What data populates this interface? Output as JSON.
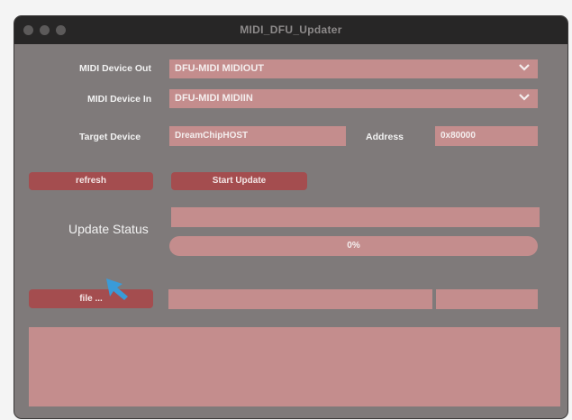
{
  "window": {
    "title": "MIDI_DFU_Updater"
  },
  "midi_out": {
    "label": "MIDI Device Out",
    "value": "DFU-MIDI MIDIOUT"
  },
  "midi_in": {
    "label": "MIDI Device In",
    "value": "DFU-MIDI MIDIIN"
  },
  "target": {
    "label": "Target Device",
    "value": "DreamChipHOST"
  },
  "address": {
    "label": "Address",
    "value": "0x80000"
  },
  "buttons": {
    "refresh": "refresh",
    "start_update": "Start Update",
    "file": "file ..."
  },
  "update_status": {
    "label": "Update Status",
    "message": "",
    "progress_text": "0%",
    "progress_fraction": 0
  },
  "file": {
    "path": "",
    "info": ""
  },
  "log": {
    "text": ""
  },
  "colors": {
    "window_bg": "#7f7a7a",
    "field_bg": "#c48d8d",
    "button_bg": "#a44d4f",
    "titlebar": "#272626",
    "cursor": "#3a9bd8"
  },
  "icons": {
    "window_controls": [
      "close-icon",
      "minimize-icon",
      "zoom-icon"
    ],
    "dropdown": "chevron-down-icon",
    "cursor": "mouse-pointer-icon"
  }
}
